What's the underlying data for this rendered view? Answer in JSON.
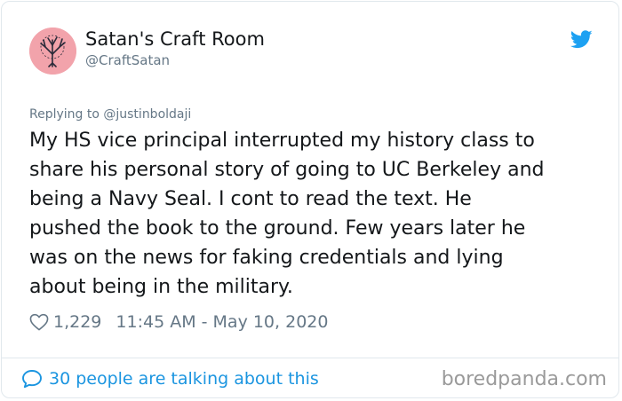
{
  "author": {
    "display_name": "Satan's Craft Room",
    "handle": "@CraftSatan",
    "avatar": "tree-avatar"
  },
  "brand": {
    "icon": "twitter-bird-icon",
    "color": "#1da1f2"
  },
  "tweet": {
    "replying_to": "Replying to @justinboldaji",
    "text": "My HS vice principal interrupted my history class to\nshare his personal story of going to UC Berkeley and\nbeing a Navy Seal. I cont to read the text. He\npushed the book to the ground. Few years later he\nwas on the news for faking credentials and lying\nabout being in the military.",
    "likes": "1,229",
    "timestamp": "11:45 AM - May 10, 2020"
  },
  "footer": {
    "talking": "30 people are talking about this",
    "link_color": "#1b95e0",
    "watermark": "boredpanda.com"
  }
}
